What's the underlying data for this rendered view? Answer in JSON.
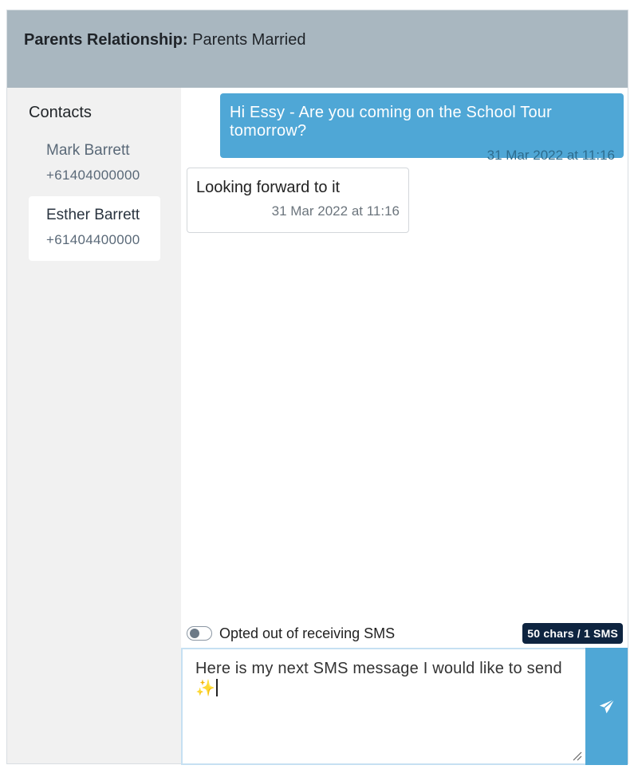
{
  "header": {
    "label": "Parents Relationship:",
    "value": "Parents Married"
  },
  "sidebar": {
    "title": "Contacts",
    "contacts": [
      {
        "name": "Mark Barrett",
        "phone": "+61404000000",
        "active": false
      },
      {
        "name": "Esther Barrett",
        "phone": "+61404400000",
        "active": true
      }
    ]
  },
  "messages": [
    {
      "direction": "outgoing",
      "text": "Hi Essy - Are you coming on the School Tour tomorrow?",
      "time": "31 Mar 2022 at 11:16"
    },
    {
      "direction": "incoming",
      "text": "Looking forward to it",
      "time": "31 Mar 2022 at 11:16"
    }
  ],
  "optout": {
    "label": "Opted out of receiving SMS",
    "checked": false
  },
  "counter": "50 chars / 1 SMS",
  "composer": {
    "value": "Here is my next SMS message I would like to send ✨"
  },
  "icons": {
    "send": "paper-plane-icon",
    "toggle": "toggle-off-icon",
    "resize": "resize-grip-icon"
  },
  "colors": {
    "accent": "#4fa7d6",
    "header_bg": "#a9b7c0",
    "counter_bg": "#0e2440"
  }
}
